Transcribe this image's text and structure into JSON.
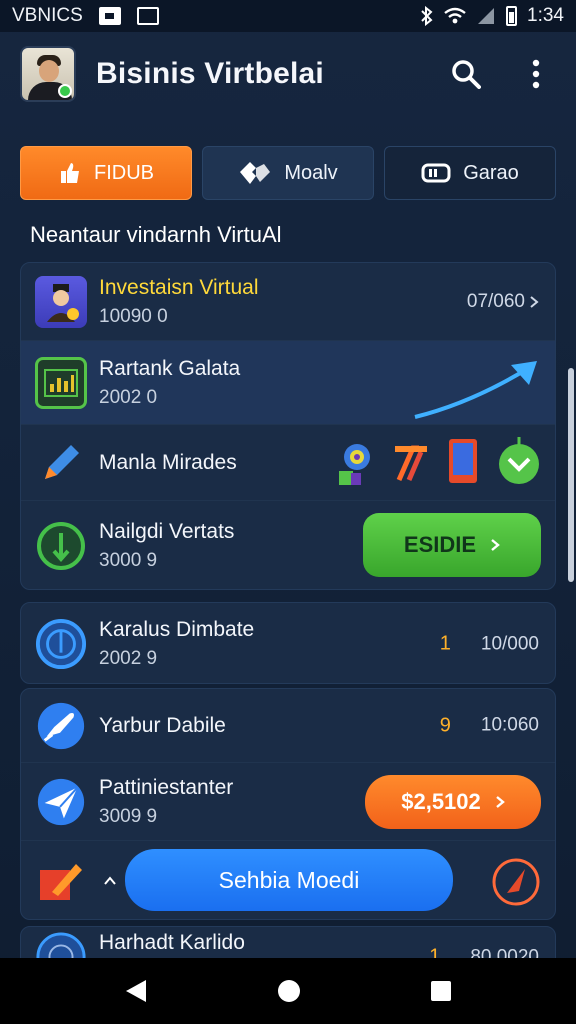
{
  "status_bar": {
    "carrier": "VBNICS",
    "time": "1:34"
  },
  "app_bar": {
    "title": "Bisinis Virtbelai"
  },
  "tabs": [
    {
      "label": "FIDUB"
    },
    {
      "label": "Moalv"
    },
    {
      "label": "Garao"
    }
  ],
  "section_title": "Neantaur vindarnh VirtuAl",
  "list_card_1": {
    "items": [
      {
        "name": "Investaisn Virtual",
        "sub": "10090 0",
        "right": "07/060"
      },
      {
        "name": "Rartank Galata",
        "sub": "2002 0"
      },
      {
        "name": "Manla Mirades"
      },
      {
        "name": "Nailgdi Vertats",
        "sub": "3000 9",
        "button_label": "ESIDIE"
      }
    ]
  },
  "list_card_2": {
    "items": [
      {
        "name": "Karalus Dimbate",
        "sub": "2002 9",
        "count": "1",
        "right": "10/000"
      },
      {
        "name": "Yarbur Dabile",
        "count": "9",
        "right": "10:060"
      },
      {
        "name": "Pattiniestanter",
        "sub": "3009 9",
        "button_label": "$2,5102"
      },
      {
        "button_label": "Sehbia Moedi"
      },
      {
        "name": "Harhadt Karlido",
        "count": "1",
        "right": "80.0020"
      }
    ]
  },
  "colors": {
    "accent_orange": "#f06a14",
    "accent_green": "#39a62c",
    "accent_blue": "#1a6ff0",
    "highlight_yellow": "#ffd93a",
    "background": "#13233a"
  }
}
